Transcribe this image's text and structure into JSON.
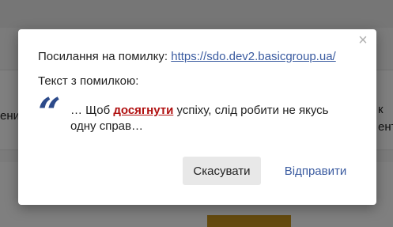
{
  "background": {
    "left_fragment": "ени",
    "right_fragment_1": "к",
    "right_fragment_2": "ент"
  },
  "dialog": {
    "close_glyph": "×",
    "link_label": "Посилання на помилку: ",
    "link_url": "https://sdo.dev2.basicgroup.ua/",
    "text_label": "Текст з помилкою:",
    "quote_glyph": "“",
    "quote_before": "… Щоб ",
    "quote_highlight": "досягнути",
    "quote_after": " успіху, слід робити не якусь одну справ…",
    "cancel_label": "Скасувати",
    "send_label": "Відправити"
  },
  "colors": {
    "accent": "#3a5ba0",
    "highlight": "#b01010",
    "quote": "#2c4a8a"
  }
}
